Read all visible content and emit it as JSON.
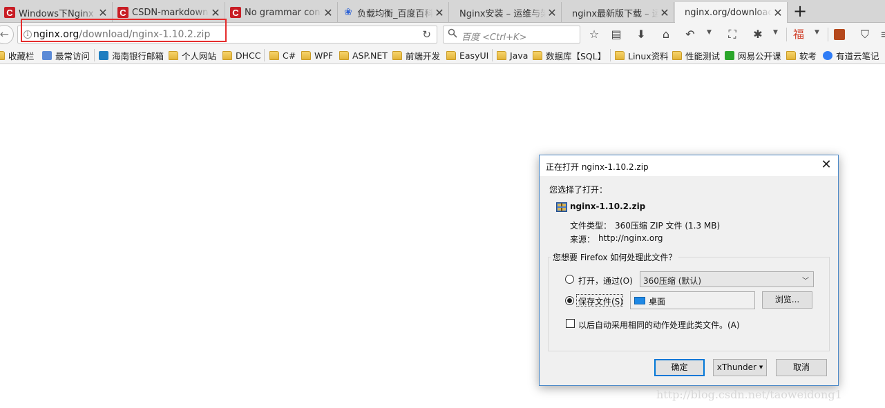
{
  "tabs": [
    {
      "title": "Windows下Nginx",
      "icon": "csdn-icon"
    },
    {
      "title": "CSDN-markdown",
      "icon": "csdn-icon"
    },
    {
      "title": "No grammar cons",
      "icon": "csdn-icon"
    },
    {
      "title": "负载均衡_百度百科",
      "icon": "baidu-paw-icon"
    },
    {
      "title": "Nginx安装 – 运维与架",
      "icon": "none"
    },
    {
      "title": "nginx最新版下载 – 运维",
      "icon": "none"
    },
    {
      "title": "nginx.org/download/",
      "icon": "none",
      "active": true
    }
  ],
  "navbar": {
    "url_host": "nginx.org",
    "url_path": "/download/nginx-1.10.2.zip",
    "search_placeholder": "百度 <Ctrl+K>"
  },
  "bookmarks": [
    {
      "label": "收藏栏",
      "icon": "folder"
    },
    {
      "label": "最常访问",
      "icon": "star"
    },
    {
      "label": "海南银行邮箱",
      "icon": "mail"
    },
    {
      "label": "个人网站",
      "icon": "folder"
    },
    {
      "label": "DHCC",
      "icon": "folder"
    },
    {
      "label": "C#",
      "icon": "folder"
    },
    {
      "label": "WPF",
      "icon": "folder"
    },
    {
      "label": "ASP.NET",
      "icon": "folder"
    },
    {
      "label": "前端开发",
      "icon": "folder"
    },
    {
      "label": "EasyUI",
      "icon": "folder"
    },
    {
      "label": "Java",
      "icon": "folder"
    },
    {
      "label": "数据库【SQL】",
      "icon": "folder"
    },
    {
      "label": "Linux资料",
      "icon": "folder"
    },
    {
      "label": "性能测试",
      "icon": "folder"
    },
    {
      "label": "网易公开课",
      "icon": "green"
    },
    {
      "label": "软考",
      "icon": "folder"
    },
    {
      "label": "有道云笔记",
      "icon": "note"
    }
  ],
  "dialog": {
    "title": "正在打开 nginx-1.10.2.zip",
    "chosen_label": "您选择了打开：",
    "filename": "nginx-1.10.2.zip",
    "type_label": "文件类型：",
    "type_value": "360压缩 ZIP 文件 (1.3 MB)",
    "source_label": "来源：",
    "source_value": "http://nginx.org",
    "question": "您想要 Firefox 如何处理此文件？",
    "open_with_label": "打开，通过(O)",
    "open_with_value": "360压缩 (默认)",
    "save_label": "保存文件(S)",
    "save_location": "桌面",
    "browse_label": "浏览...",
    "auto_label": "以后自动采用相同的动作处理此类文件。(A)",
    "ok_label": "确定",
    "xthunder_label": "xThunder",
    "cancel_label": "取消",
    "selected_action": "save",
    "auto_checked": false
  },
  "watermark": "http://blog.csdn.net/taoweidong1"
}
